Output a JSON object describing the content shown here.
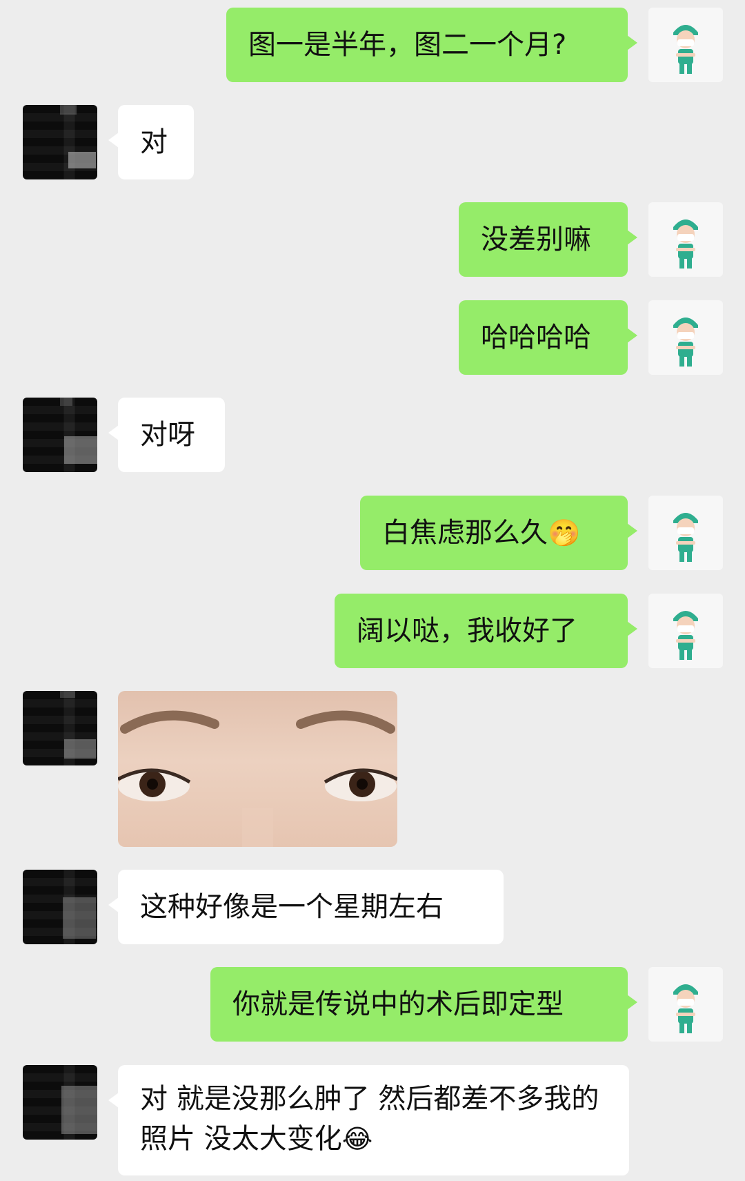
{
  "messages": [
    {
      "side": "out",
      "text": "图一是半年，图二一个月?"
    },
    {
      "side": "in",
      "text": "对"
    },
    {
      "side": "out",
      "text": "没差别嘛"
    },
    {
      "side": "out",
      "text": "哈哈哈哈"
    },
    {
      "side": "in",
      "text": "对呀"
    },
    {
      "side": "out",
      "text": "白焦虑那么久",
      "emoji": "🤭"
    },
    {
      "side": "out",
      "text": "阔以哒，我收好了"
    },
    {
      "side": "in",
      "type": "image"
    },
    {
      "side": "in",
      "text": "这种好像是一个星期左右"
    },
    {
      "side": "out",
      "text": "你就是传说中的术后即定型"
    },
    {
      "side": "in",
      "text": "对 就是没那么肿了 然后都差不多我的照片 没太大变化",
      "emoji": "😂"
    }
  ],
  "icons": {
    "right_avatar": "nurse-avatar-icon",
    "left_avatar": "pixelated-avatar"
  },
  "colors": {
    "background": "#ededed",
    "outgoing_bubble": "#95ec69",
    "incoming_bubble": "#ffffff",
    "nurse_cap": "#2fae8f"
  }
}
